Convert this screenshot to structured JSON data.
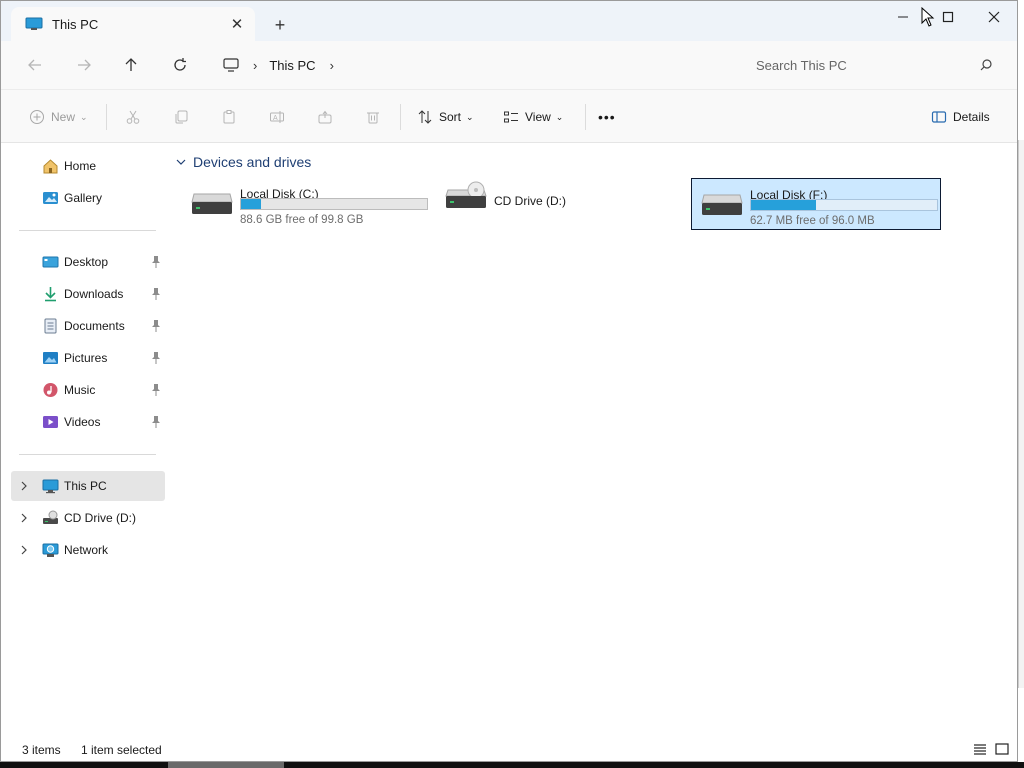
{
  "tab": {
    "title": "This PC",
    "close": "✕",
    "new_tab": "+"
  },
  "window_controls": {
    "minimize": "minimize-icon",
    "maximize": "maximize-icon",
    "close": "close-icon"
  },
  "address": {
    "chevron": "›",
    "crumb": "This PC",
    "crumb_chevron": "›"
  },
  "search": {
    "placeholder": "Search This PC"
  },
  "commands": {
    "new": "New",
    "sort": "Sort",
    "view": "View",
    "more": "•••",
    "details": "Details"
  },
  "sidebar": {
    "quick": [
      {
        "label": "Home"
      },
      {
        "label": "Gallery"
      }
    ],
    "pinned": [
      {
        "label": "Desktop"
      },
      {
        "label": "Downloads"
      },
      {
        "label": "Documents"
      },
      {
        "label": "Pictures"
      },
      {
        "label": "Music"
      },
      {
        "label": "Videos"
      }
    ],
    "locations": [
      {
        "label": "This PC",
        "selected": true
      },
      {
        "label": "CD Drive (D:)"
      },
      {
        "label": "Network"
      }
    ]
  },
  "main": {
    "group_title": "Devices and drives",
    "drives": [
      {
        "name": "Local Disk (C:)",
        "size_text": "88.6 GB free of 99.8 GB",
        "used_fraction": 0.11,
        "selected": false
      },
      {
        "name": "CD Drive (D:)",
        "size_text": "",
        "used_fraction": null,
        "selected": false
      },
      {
        "name": "Local Disk (F:)",
        "size_text": "62.7 MB free of 96.0 MB",
        "used_fraction": 0.35,
        "selected": true
      }
    ]
  },
  "status": {
    "items": "3 items",
    "selected": "1 item selected"
  },
  "colors": {
    "accent": "#26a0da",
    "selection_bg": "#cce8ff",
    "group_header": "#1f3f73"
  }
}
